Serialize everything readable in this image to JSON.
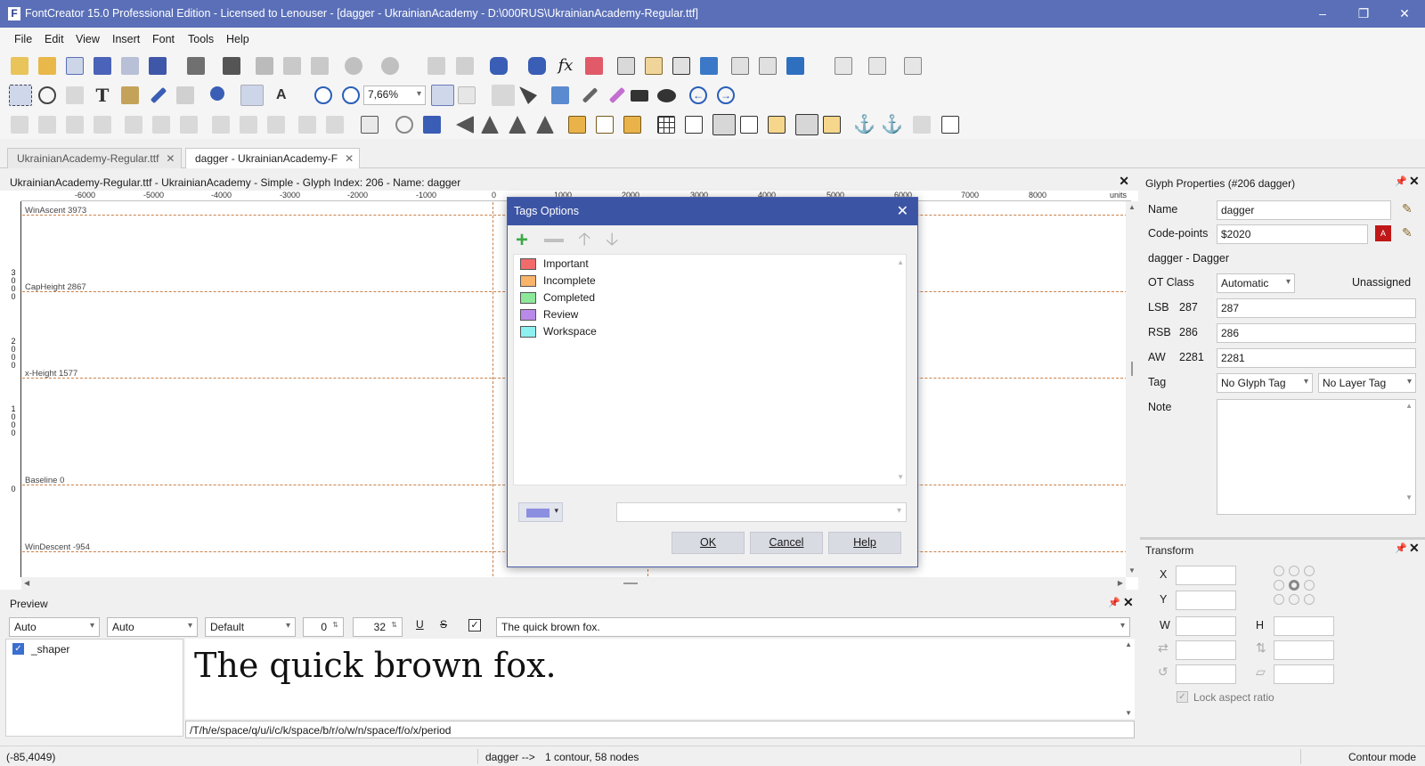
{
  "window": {
    "title": "FontCreator 15.0 Professional Edition - Licensed to Lenouser - [dagger - UkrainianAcademy - D:\\000RUS\\UkrainianAcademy-Regular.ttf]",
    "app_icon": "F"
  },
  "menu": [
    "File",
    "Edit",
    "View",
    "Insert",
    "Font",
    "Tools",
    "Help"
  ],
  "toolbar": {
    "zoom": "7,66%"
  },
  "tabs": [
    {
      "label": "UkrainianAcademy-Regular.ttf",
      "active": false
    },
    {
      "label": "dagger - UkrainianAcademy-F",
      "active": true
    }
  ],
  "glyph_panel": {
    "header": "UkrainianAcademy-Regular.ttf - UkrainianAcademy - Simple - Glyph Index: 206 - Name: dagger",
    "ruler_ticks": [
      "-6000",
      "-5000",
      "-4000",
      "-3000",
      "-2000",
      "-1000",
      "0",
      "1000",
      "2000",
      "3000",
      "4000",
      "5000",
      "6000",
      "7000",
      "8000"
    ],
    "ruler_units": "units",
    "vruler_labels": [
      "3\n0\n0\n0",
      "2\n0\n0\n0",
      "1\n0\n0\n0",
      "0"
    ],
    "guidelines": [
      {
        "label": "WinAscent 3973"
      },
      {
        "label": "CapHeight 2867"
      },
      {
        "label": "x-Height 1577"
      },
      {
        "label": "Baseline 0"
      },
      {
        "label": "WinDescent -954"
      }
    ]
  },
  "preview": {
    "title": "Preview",
    "selects": [
      "Auto",
      "Auto",
      "Default"
    ],
    "spin1": "0",
    "spin2": "32",
    "underline_label": "U",
    "strike_label": "S",
    "text": "The quick brown fox.",
    "shaper": "_shaper",
    "glyph_sequence": "/T/h/e/space/q/u/i/c/k/space/b/r/o/w/n/space/f/o/x/period"
  },
  "properties": {
    "title": "Glyph Properties (#206 dagger)",
    "name_label": "Name",
    "name": "dagger",
    "codepoints_label": "Code-points",
    "codepoints": "$2020",
    "description": "dagger - Dagger",
    "otclass_label": "OT Class",
    "otclass": "Automatic",
    "unassigned": "Unassigned",
    "lsb_label": "LSB",
    "lsb": "287",
    "lsb_value": "287",
    "rsb_label": "RSB",
    "rsb": "286",
    "rsb_value": "286",
    "aw_label": "AW",
    "aw": "2281",
    "aw_value": "2281",
    "tag_label": "Tag",
    "glyph_tag": "No Glyph Tag",
    "layer_tag": "No Layer Tag",
    "note_label": "Note"
  },
  "transform": {
    "title": "Transform",
    "x_label": "X",
    "y_label": "Y",
    "w_label": "W",
    "h_label": "H",
    "lock_aspect": "Lock aspect ratio"
  },
  "status": {
    "coords": "(-85,4049)",
    "glyph": "dagger -->",
    "info": "1 contour, 58 nodes",
    "mode": "Contour mode"
  },
  "dialog": {
    "title": "Tags Options",
    "tags": [
      {
        "label": "Important",
        "color": "#f26b6b"
      },
      {
        "label": "Incomplete",
        "color": "#f9b46a"
      },
      {
        "label": "Completed",
        "color": "#8ee89a"
      },
      {
        "label": "Review",
        "color": "#b98ae8"
      },
      {
        "label": "Workspace",
        "color": "#8ef0f0"
      }
    ],
    "color_swatch": "#8c8fe0",
    "ok": "OK",
    "cancel": "Cancel",
    "help": "Help"
  }
}
